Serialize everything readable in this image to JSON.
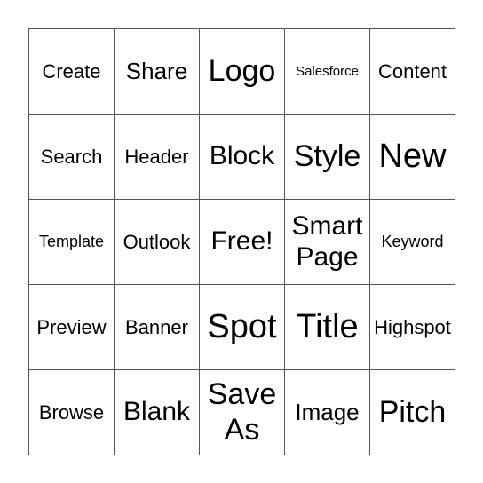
{
  "board": {
    "cells": [
      [
        "Create",
        "Share",
        "Logo",
        "Salesforce",
        "Content"
      ],
      [
        "Search",
        "Header",
        "Block",
        "Style",
        "New"
      ],
      [
        "Template",
        "Outlook",
        "Free!",
        "Smart Page",
        "Keyword"
      ],
      [
        "Preview",
        "Banner",
        "Spot",
        "Title",
        "Highspot"
      ],
      [
        "Browse",
        "Blank",
        "Save As",
        "Image",
        "Pitch"
      ]
    ]
  }
}
